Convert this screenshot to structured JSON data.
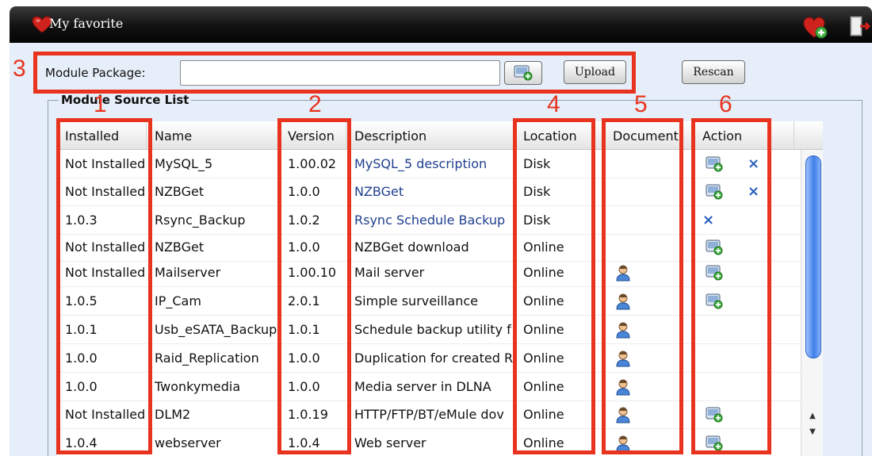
{
  "window": {
    "title": "My favorite"
  },
  "package": {
    "label": "Module Package:",
    "input_value": "",
    "upload_label": "Upload",
    "rescan_label": "Rescan"
  },
  "source_list": {
    "legend": "Module Source List",
    "columns": [
      "Installed",
      "Name",
      "Version",
      "Description",
      "Location",
      "Document",
      "Action"
    ],
    "rows": [
      {
        "installed": "Not Installed",
        "name": "MySQL_5",
        "version": "1.00.02",
        "description": "MySQL_5 description",
        "location": "Disk",
        "document": false,
        "install": true,
        "delete": true,
        "link": true
      },
      {
        "installed": "Not Installed",
        "name": "NZBGet",
        "version": "1.0.0",
        "description": "NZBGet",
        "location": "Disk",
        "document": false,
        "install": true,
        "delete": true,
        "link": true
      },
      {
        "installed": "1.0.3",
        "name": "Rsync_Backup",
        "version": "1.0.2",
        "description": "Rsync Schedule Backup",
        "location": "Disk",
        "document": false,
        "install": false,
        "delete": true,
        "link": true
      },
      {
        "installed": "Not Installed",
        "name": "NZBGet",
        "version": "1.0.0",
        "description": "NZBGet download",
        "location": "Online",
        "document": false,
        "install": true,
        "delete": false,
        "link": false
      },
      {
        "installed": "Not Installed",
        "name": "Mailserver",
        "version": "1.00.10",
        "description": "Mail server",
        "location": "Online",
        "document": true,
        "install": true,
        "delete": false,
        "link": false
      },
      {
        "installed": "1.0.5",
        "name": "IP_Cam",
        "version": "2.0.1",
        "description": "Simple surveillance",
        "location": "Online",
        "document": true,
        "install": true,
        "delete": false,
        "link": false
      },
      {
        "installed": "1.0.1",
        "name": "Usb_eSATA_Backup",
        "version": "1.0.1",
        "description": "Schedule backup utility f",
        "location": "Online",
        "document": true,
        "install": false,
        "delete": false,
        "link": false
      },
      {
        "installed": "1.0.0",
        "name": "Raid_Replication",
        "version": "1.0.0",
        "description": "Duplication for created R",
        "location": "Online",
        "document": true,
        "install": false,
        "delete": false,
        "link": false
      },
      {
        "installed": "1.0.0",
        "name": "Twonkymedia",
        "version": "1.0.0",
        "description": "Media server in DLNA",
        "location": "Online",
        "document": true,
        "install": false,
        "delete": false,
        "link": false
      },
      {
        "installed": "Not Installed",
        "name": "DLM2",
        "version": "1.0.19",
        "description": "HTTP/FTP/BT/eMule dov",
        "location": "Online",
        "document": true,
        "install": true,
        "delete": false,
        "link": false
      },
      {
        "installed": "1.0.4",
        "name": "webserver",
        "version": "1.0.4",
        "description": "Web server",
        "location": "Online",
        "document": true,
        "install": true,
        "delete": false,
        "link": false
      }
    ]
  },
  "annotations": [
    "1",
    "2",
    "3",
    "4",
    "5",
    "6"
  ],
  "colors": {
    "annotation": "#e8341f",
    "link": "#1f3f8f",
    "header_bg": "#111111",
    "panel_bg": "#e6eef9"
  },
  "icons": {
    "title": "heart-icon",
    "favorite_add": "heart-add-icon",
    "logout": "exit-door-icon",
    "browse": "browse-icon",
    "install": "install-icon",
    "delete": "delete-x-icon",
    "document": "person-doc-icon"
  }
}
